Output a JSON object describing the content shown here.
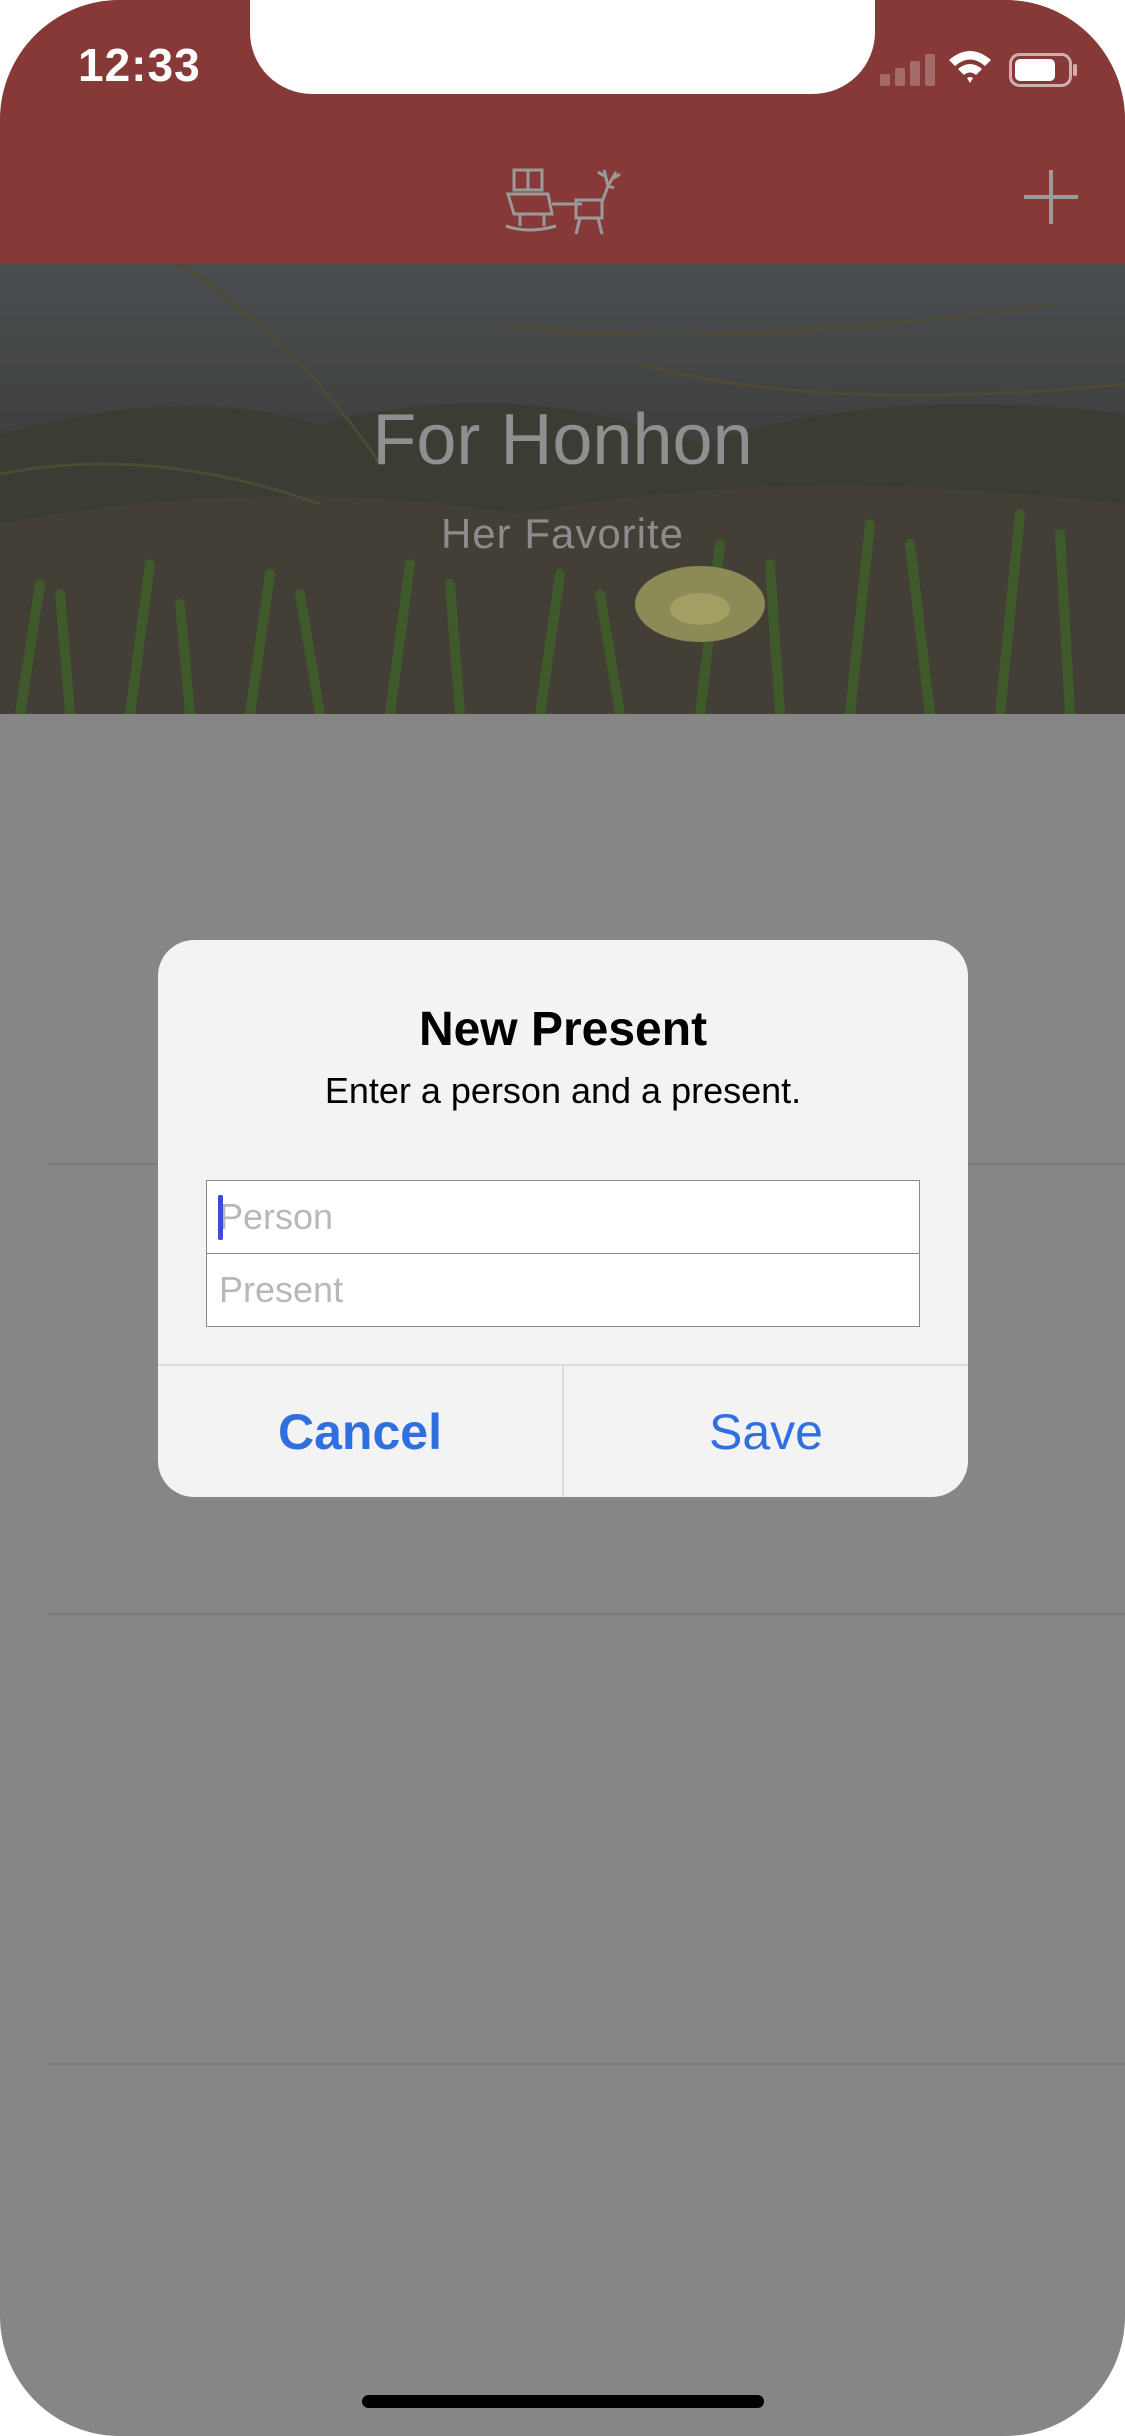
{
  "status_bar": {
    "time": "12:33",
    "signal_icon": "cellular-signal-icon",
    "wifi_icon": "wifi-icon",
    "battery_icon": "battery-icon"
  },
  "nav_bar": {
    "logo_icon": "sleigh-reindeer-logo-icon",
    "add_icon": "plus-icon",
    "background_color": "#873937"
  },
  "hero": {
    "title": "For Honhon",
    "subtitle": "Her Favorite"
  },
  "alert": {
    "title": "New Present",
    "message": "Enter a person and a present.",
    "fields": {
      "person_placeholder": "Person",
      "person_value": "",
      "present_placeholder": "Present",
      "present_value": ""
    },
    "buttons": {
      "cancel": "Cancel",
      "save": "Save"
    },
    "accent_color": "#2f6fe0"
  }
}
